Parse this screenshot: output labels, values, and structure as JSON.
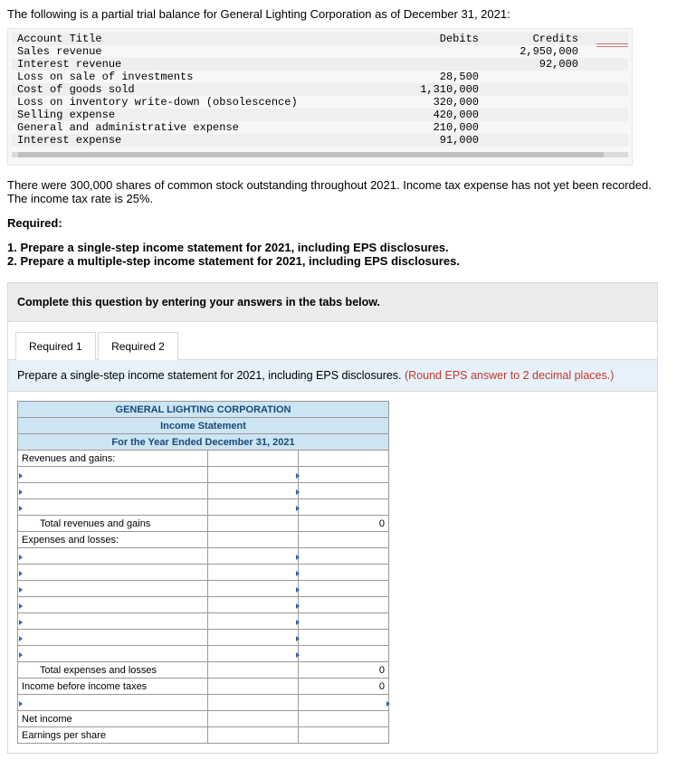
{
  "intro": "The following is a partial trial balance for General Lighting Corporation as of December 31, 2021:",
  "tb": {
    "h_debits": "Debits",
    "h_credits": "Credits",
    "rows": [
      {
        "a": "Account Title",
        "d": "",
        "c": ""
      },
      {
        "a": "Sales revenue",
        "d": "",
        "c": "2,950,000"
      },
      {
        "a": "Interest revenue",
        "d": "",
        "c": "92,000"
      },
      {
        "a": "Loss on sale of investments",
        "d": "28,500",
        "c": ""
      },
      {
        "a": "Cost of goods sold",
        "d": "1,310,000",
        "c": ""
      },
      {
        "a": "Loss on inventory write-down (obsolescence)",
        "d": "320,000",
        "c": ""
      },
      {
        "a": "Selling expense",
        "d": "420,000",
        "c": ""
      },
      {
        "a": "General and administrative expense",
        "d": "210,000",
        "c": ""
      },
      {
        "a": "Interest expense",
        "d": "91,000",
        "c": ""
      }
    ]
  },
  "para_after_tb": "There were 300,000 shares of common stock outstanding throughout 2021. Income tax expense has not yet been recorded. The income tax rate is 25%.",
  "required_label": "Required:",
  "req1": "1. Prepare a single-step income statement for 2021, including EPS disclosures.",
  "req2": "2. Prepare a multiple-step income statement for 2021, including EPS disclosures.",
  "panel_hdr": "Complete this question by entering your answers in the tabs below.",
  "tab1": "Required 1",
  "tab2": "Required 2",
  "subhdr_main": "Prepare a single-step income statement for 2021, including EPS disclosures. ",
  "subhdr_hint": "(Round EPS answer to 2 decimal places.)",
  "stmt": {
    "company": "GENERAL LIGHTING CORPORATION",
    "title": "Income Statement",
    "period": "For the Year Ended December 31, 2021",
    "rev_hdr": "Revenues and gains:",
    "total_rev": "Total revenues and gains",
    "zero": "0",
    "exp_hdr": "Expenses and losses:",
    "total_exp": "Total expenses and losses",
    "income_pretax": "Income before income taxes",
    "net_income": "Net income",
    "eps": "Earnings per share"
  }
}
